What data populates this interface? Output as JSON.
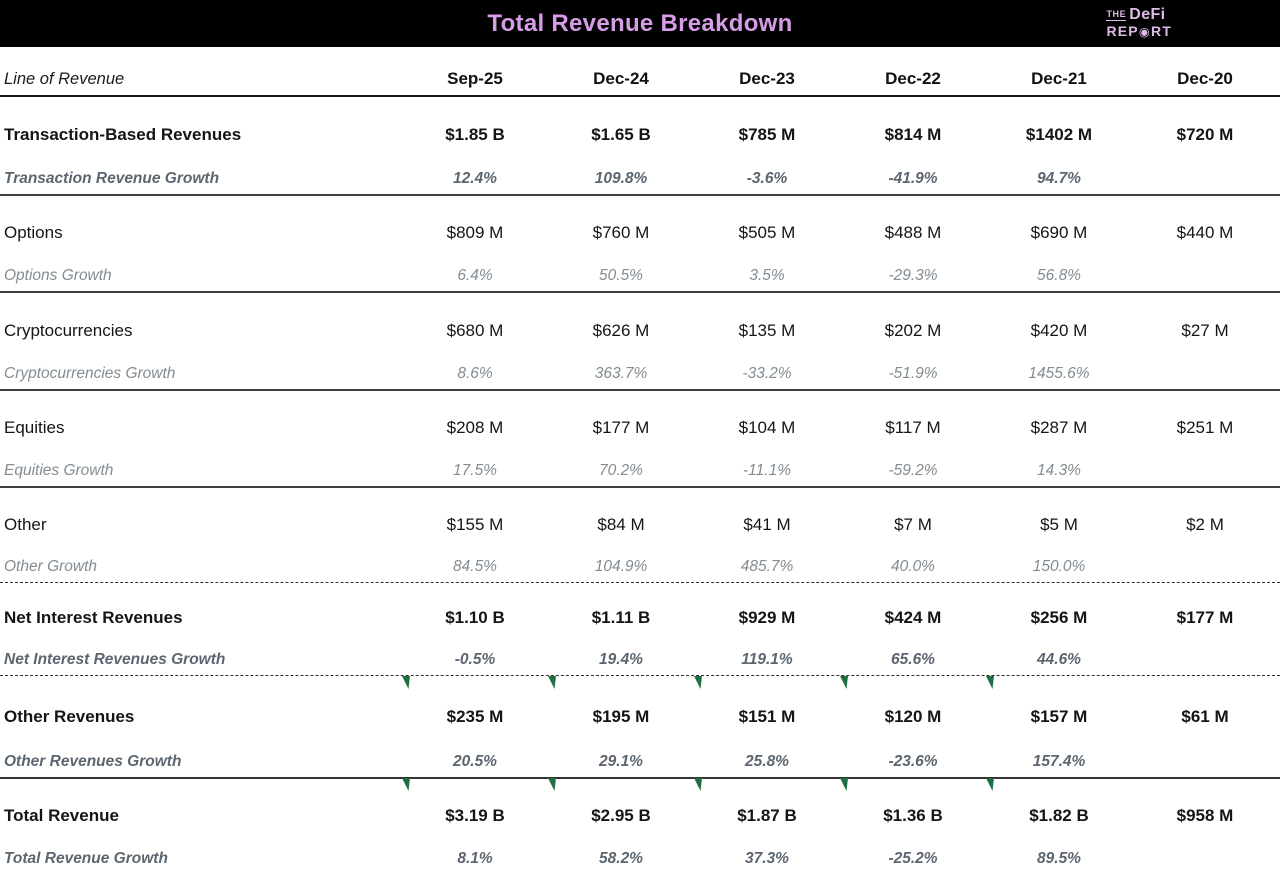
{
  "header": {
    "title": "Total Revenue Breakdown",
    "logo": {
      "the": "THE",
      "defi": "DeFi",
      "rep": "REP",
      "o_symbol": "◉",
      "rt": "RT"
    }
  },
  "table": {
    "label_header": "Line of Revenue",
    "columns": [
      "Sep-25",
      "Dec-24",
      "Dec-23",
      "Dec-22",
      "Dec-21",
      "Dec-20"
    ],
    "sections": [
      {
        "label": "Transaction-Based Revenues",
        "values": [
          "$1.85 B",
          "$1.65 B",
          "$785 M",
          "$814 M",
          "$1402 M",
          "$720 M"
        ],
        "growth_label": "Transaction Revenue Growth",
        "growth": [
          "12.4%",
          "109.8%",
          "-3.6%",
          "-41.9%",
          "94.7%",
          ""
        ]
      },
      {
        "label": "Options",
        "values": [
          "$809 M",
          "$760 M",
          "$505 M",
          "$488 M",
          "$690 M",
          "$440 M"
        ],
        "growth_label": "Options Growth",
        "growth": [
          "6.4%",
          "50.5%",
          "3.5%",
          "-29.3%",
          "56.8%",
          ""
        ]
      },
      {
        "label": "Cryptocurrencies",
        "values": [
          "$680 M",
          "$626 M",
          "$135 M",
          "$202 M",
          "$420 M",
          "$27 M"
        ],
        "growth_label": "Cryptocurrencies Growth",
        "growth": [
          "8.6%",
          "363.7%",
          "-33.2%",
          "-51.9%",
          "1455.6%",
          ""
        ]
      },
      {
        "label": "Equities",
        "values": [
          "$208 M",
          "$177 M",
          "$104 M",
          "$117 M",
          "$287 M",
          "$251 M"
        ],
        "growth_label": "Equities Growth",
        "growth": [
          "17.5%",
          "70.2%",
          "-11.1%",
          "-59.2%",
          "14.3%",
          ""
        ]
      },
      {
        "label": "Other",
        "values": [
          "$155 M",
          "$84 M",
          "$41 M",
          "$7 M",
          "$5 M",
          "$2 M"
        ],
        "growth_label": "Other Growth",
        "growth": [
          "84.5%",
          "104.9%",
          "485.7%",
          "40.0%",
          "150.0%",
          ""
        ]
      },
      {
        "label": "Net Interest Revenues",
        "values": [
          "$1.10 B",
          "$1.11 B",
          "$929 M",
          "$424 M",
          "$256 M",
          "$177 M"
        ],
        "growth_label": "Net Interest Revenues Growth",
        "growth": [
          "-0.5%",
          "19.4%",
          "119.1%",
          "65.6%",
          "44.6%",
          ""
        ]
      },
      {
        "label": "Other Revenues",
        "values": [
          "$235 M",
          "$195 M",
          "$151 M",
          "$120 M",
          "$157 M",
          "$61 M"
        ],
        "growth_label": "Other Revenues Growth",
        "growth": [
          "20.5%",
          "29.1%",
          "25.8%",
          "-23.6%",
          "157.4%",
          ""
        ]
      },
      {
        "label": "Total Revenue",
        "values": [
          "$3.19 B",
          "$2.95 B",
          "$1.87 B",
          "$1.36 B",
          "$1.82 B",
          "$958 M"
        ],
        "growth_label": "Total Revenue Growth",
        "growth": [
          "8.1%",
          "58.2%",
          "37.3%",
          "-25.2%",
          "89.5%",
          ""
        ]
      }
    ]
  },
  "chart_data": {
    "type": "table",
    "title": "Total Revenue Breakdown",
    "columns": [
      "Line of Revenue",
      "Sep-25",
      "Dec-24",
      "Dec-23",
      "Dec-22",
      "Dec-21",
      "Dec-20"
    ],
    "rows": [
      [
        "Transaction-Based Revenues",
        "$1.85 B",
        "$1.65 B",
        "$785 M",
        "$814 M",
        "$1402 M",
        "$720 M"
      ],
      [
        "Transaction Revenue Growth",
        "12.4%",
        "109.8%",
        "-3.6%",
        "-41.9%",
        "94.7%",
        ""
      ],
      [
        "Options",
        "$809 M",
        "$760 M",
        "$505 M",
        "$488 M",
        "$690 M",
        "$440 M"
      ],
      [
        "Options Growth",
        "6.4%",
        "50.5%",
        "3.5%",
        "-29.3%",
        "56.8%",
        ""
      ],
      [
        "Cryptocurrencies",
        "$680 M",
        "$626 M",
        "$135 M",
        "$202 M",
        "$420 M",
        "$27 M"
      ],
      [
        "Cryptocurrencies Growth",
        "8.6%",
        "363.7%",
        "-33.2%",
        "-51.9%",
        "1455.6%",
        ""
      ],
      [
        "Equities",
        "$208 M",
        "$177 M",
        "$104 M",
        "$117 M",
        "$287 M",
        "$251 M"
      ],
      [
        "Equities Growth",
        "17.5%",
        "70.2%",
        "-11.1%",
        "-59.2%",
        "14.3%",
        ""
      ],
      [
        "Other",
        "$155 M",
        "$84 M",
        "$41 M",
        "$7 M",
        "$5 M",
        "$2 M"
      ],
      [
        "Other Growth",
        "84.5%",
        "104.9%",
        "485.7%",
        "40.0%",
        "150.0%",
        ""
      ],
      [
        "Net Interest Revenues",
        "$1.10 B",
        "$1.11 B",
        "$929 M",
        "$424 M",
        "$256 M",
        "$177 M"
      ],
      [
        "Net Interest Revenues Growth",
        "-0.5%",
        "19.4%",
        "119.1%",
        "65.6%",
        "44.6%",
        ""
      ],
      [
        "Other Revenues",
        "$235 M",
        "$195 M",
        "$151 M",
        "$120 M",
        "$157 M",
        "$61 M"
      ],
      [
        "Other Revenues Growth",
        "20.5%",
        "29.1%",
        "25.8%",
        "-23.6%",
        "157.4%",
        ""
      ],
      [
        "Total Revenue",
        "$3.19 B",
        "$2.95 B",
        "$1.87 B",
        "$1.36 B",
        "$1.82 B",
        "$958 M"
      ],
      [
        "Total Revenue Growth",
        "8.1%",
        "58.2%",
        "37.3%",
        "-25.2%",
        "89.5%",
        ""
      ]
    ]
  },
  "colors": {
    "banner_bg": "#000000",
    "title_pink": "#d79ce6",
    "logo_pink": "#dcb9e6",
    "flag_green": "#1e7043",
    "growth_gray_bold": "#5c6670",
    "growth_gray_regular": "#838c92",
    "text_black": "#111111"
  }
}
